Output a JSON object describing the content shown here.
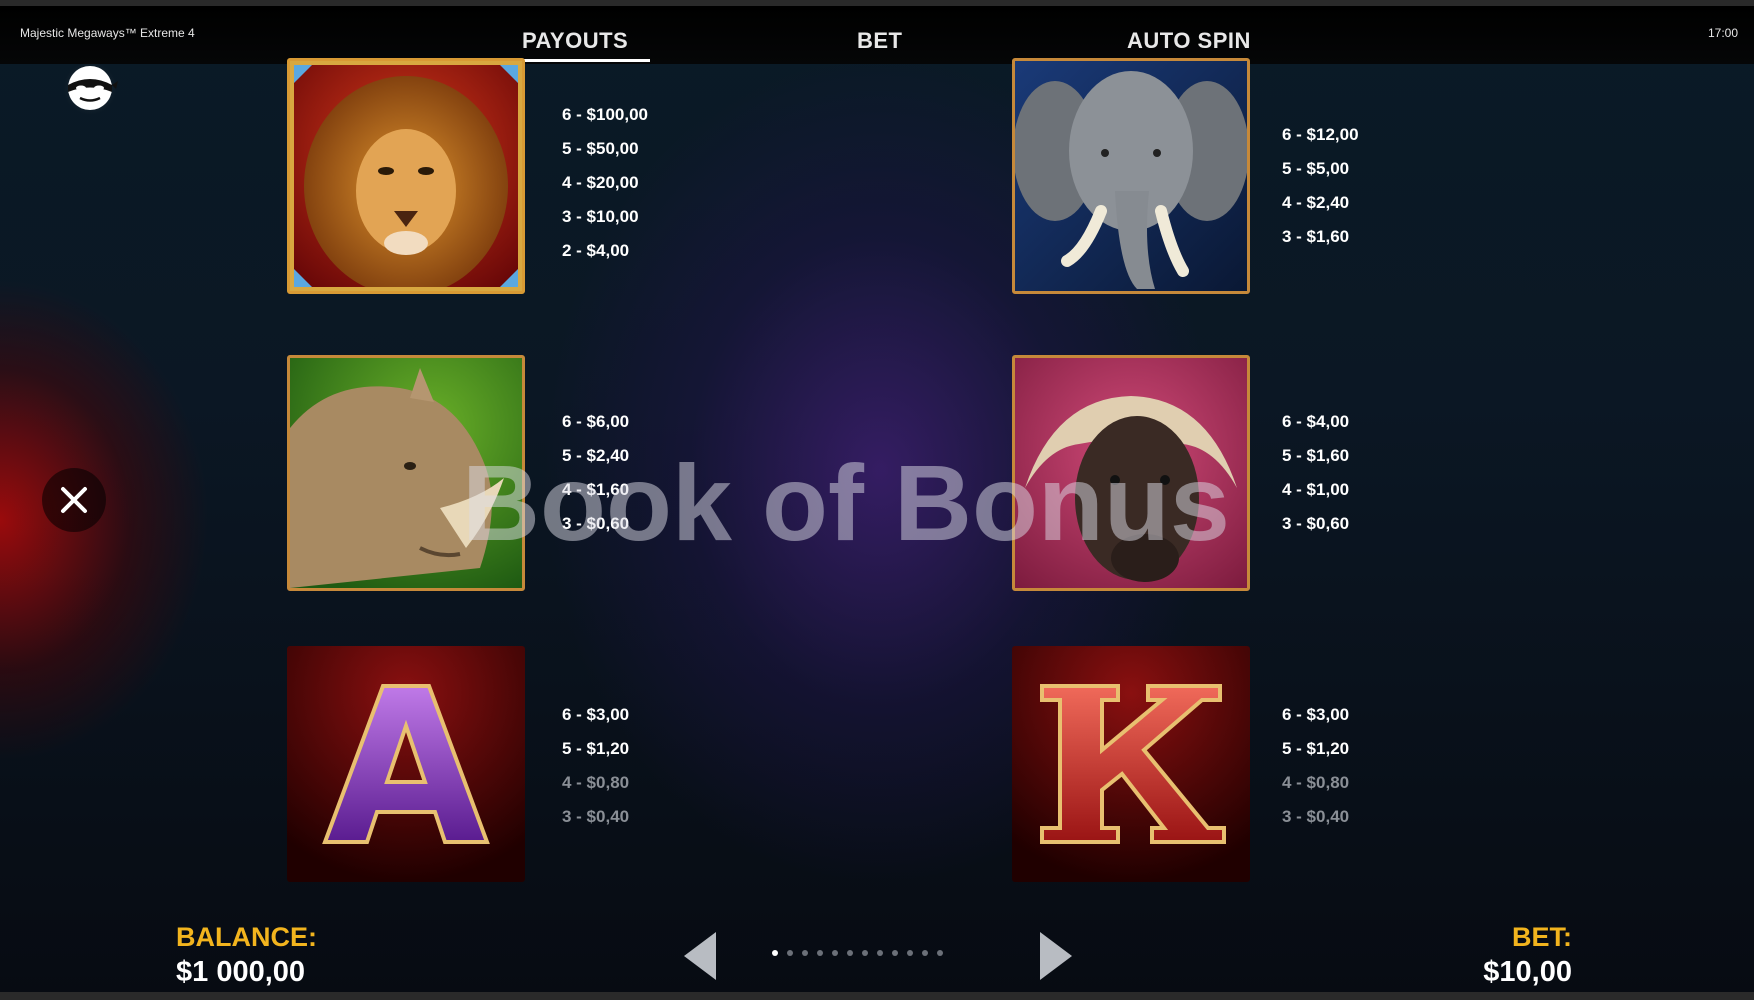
{
  "window": {
    "title": "Majestic Megaways™ Extreme 4",
    "clock": "17:00"
  },
  "tabs": [
    {
      "label": "PAYOUTS",
      "active": true
    },
    {
      "label": "BET",
      "active": false
    },
    {
      "label": "AUTO SPIN",
      "active": false
    }
  ],
  "symbols": [
    {
      "name": "lion",
      "payouts": [
        "6 - $100,00",
        "5 - $50,00",
        "4 - $20,00",
        "3 - $10,00",
        "2 - $4,00"
      ]
    },
    {
      "name": "elephant",
      "payouts": [
        "6 - $12,00",
        "5 - $5,00",
        "4 - $2,40",
        "3 - $1,60"
      ]
    },
    {
      "name": "rhino",
      "payouts": [
        "6 - $6,00",
        "5 - $2,40",
        "4 - $1,60",
        "3 - $0,60"
      ]
    },
    {
      "name": "buffalo",
      "payouts": [
        "6 - $4,00",
        "5 - $1,60",
        "4 - $1,00",
        "3 - $0,60"
      ]
    },
    {
      "name": "ace",
      "glyph": "A",
      "payouts": [
        "6 - $3,00",
        "5 - $1,20",
        "4 - $0,80",
        "3 - $0,40"
      ]
    },
    {
      "name": "king",
      "glyph": "K",
      "payouts": [
        "6 - $3,00",
        "5 - $1,20",
        "4 - $0,80",
        "3 - $0,40"
      ]
    }
  ],
  "watermark": "Book of Bonus",
  "footer": {
    "balance_label": "BALANCE:",
    "balance_value": "$1 000,00",
    "bet_label": "BET:",
    "bet_value": "$10,00",
    "page_count": 12,
    "current_page": 1
  },
  "colors": {
    "accent_gold": "#f2b41e",
    "frame": "#c6893a",
    "ace": "#7a2fb0",
    "king": "#c62a2a"
  },
  "icons": {
    "logo": "masked-face-icon",
    "close": "close-icon",
    "prev": "arrow-left-icon",
    "next": "arrow-right-icon"
  }
}
